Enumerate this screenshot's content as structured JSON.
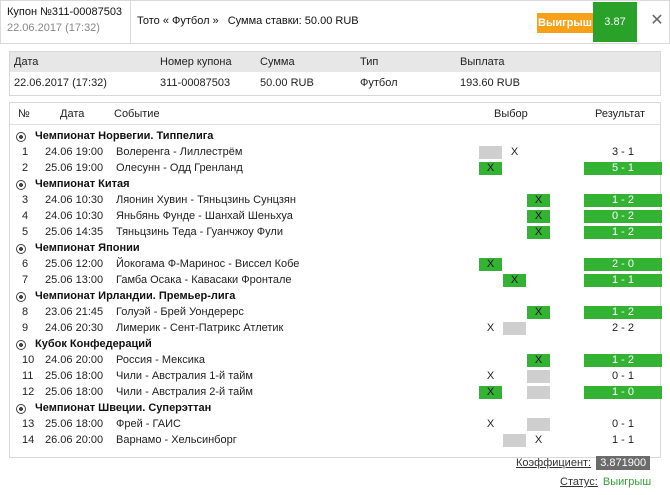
{
  "header": {
    "coupon_title": "Купон №311-00087503",
    "coupon_date": "22.06.2017 (17:32)",
    "type_text": "Тото « Футбол »",
    "sum_text": "Сумма ставки: 50.00 RUB",
    "win_badge": "Выигрыш",
    "coefficient": "3.87",
    "close_icon": "close-icon",
    "colors": {
      "win_badge": "#f7a11a",
      "coefficient_bg": "#2aa22a"
    }
  },
  "summary": {
    "headers": [
      "Дата",
      "Номер купона",
      "Сумма",
      "Тип",
      "Выплата"
    ],
    "values": [
      "22.06.2017 (17:32)",
      "311-00087503",
      "50.00 RUB",
      "Футбол",
      "193.60 RUB"
    ]
  },
  "matches": {
    "headers": {
      "num": "№",
      "date": "Дата",
      "event": "Событие",
      "choice": "Выбор",
      "result": "Результат"
    },
    "groups": [
      {
        "name": "Чемпионат Норвегии. Типпелига",
        "rows": [
          {
            "num": "1",
            "date": "24.06 19:00",
            "event": "Волеренга - Лиллестрём",
            "result": "3 - 1",
            "result_win": false,
            "sel": [
              {
                "kind": "grey",
                "text": ""
              },
              {
                "kind": "plain",
                "text": "X"
              },
              {
                "kind": "none",
                "text": ""
              }
            ]
          },
          {
            "num": "2",
            "date": "25.06 19:00",
            "event": "Олесунн - Одд Гренланд",
            "result": "5 - 1",
            "result_win": true,
            "sel": [
              {
                "kind": "green",
                "text": "X"
              },
              {
                "kind": "none",
                "text": ""
              },
              {
                "kind": "none",
                "text": ""
              }
            ]
          }
        ]
      },
      {
        "name": "Чемпионат Китая",
        "rows": [
          {
            "num": "3",
            "date": "24.06 10:30",
            "event": "Ляонин Хувин - Тяньцзинь Сунцзян",
            "result": "1 - 2",
            "result_win": true,
            "sel": [
              {
                "kind": "none",
                "text": ""
              },
              {
                "kind": "none",
                "text": ""
              },
              {
                "kind": "green",
                "text": "X"
              }
            ]
          },
          {
            "num": "4",
            "date": "24.06 10:30",
            "event": "Яньбянь Фунде - Шанхай Шеньхуа",
            "result": "0 - 2",
            "result_win": true,
            "sel": [
              {
                "kind": "none",
                "text": ""
              },
              {
                "kind": "none",
                "text": ""
              },
              {
                "kind": "green",
                "text": "X"
              }
            ]
          },
          {
            "num": "5",
            "date": "25.06 14:35",
            "event": "Тяньцзинь Теда - Гуанчжоу Фули",
            "result": "1 - 2",
            "result_win": true,
            "sel": [
              {
                "kind": "none",
                "text": ""
              },
              {
                "kind": "none",
                "text": ""
              },
              {
                "kind": "green",
                "text": "X"
              }
            ]
          }
        ]
      },
      {
        "name": "Чемпионат Японии",
        "rows": [
          {
            "num": "6",
            "date": "25.06 12:00",
            "event": "Йокогама Ф-Маринос - Виссел Кобе",
            "result": "2 - 0",
            "result_win": true,
            "sel": [
              {
                "kind": "green",
                "text": "X"
              },
              {
                "kind": "none",
                "text": ""
              },
              {
                "kind": "none",
                "text": ""
              }
            ]
          },
          {
            "num": "7",
            "date": "25.06 13:00",
            "event": "Гамба Осака - Кавасаки Фронтале",
            "result": "1 - 1",
            "result_win": true,
            "sel": [
              {
                "kind": "none",
                "text": ""
              },
              {
                "kind": "green",
                "text": "X"
              },
              {
                "kind": "none",
                "text": ""
              }
            ]
          }
        ]
      },
      {
        "name": "Чемпионат Ирландии. Премьер-лига",
        "rows": [
          {
            "num": "8",
            "date": "23.06 21:45",
            "event": "Голуэй - Брей Уондерерс",
            "result": "1 - 2",
            "result_win": true,
            "sel": [
              {
                "kind": "none",
                "text": ""
              },
              {
                "kind": "none",
                "text": ""
              },
              {
                "kind": "green",
                "text": "X"
              }
            ]
          },
          {
            "num": "9",
            "date": "24.06 20:30",
            "event": "Лимерик - Сент-Патрикс Атлетик",
            "result": "2 - 2",
            "result_win": false,
            "sel": [
              {
                "kind": "plain",
                "text": "X"
              },
              {
                "kind": "grey",
                "text": ""
              },
              {
                "kind": "none",
                "text": ""
              }
            ]
          }
        ]
      },
      {
        "name": "Кубок Конфедераций",
        "rows": [
          {
            "num": "10",
            "date": "24.06 20:00",
            "event": "Россия - Мексика",
            "result": "1 - 2",
            "result_win": true,
            "sel": [
              {
                "kind": "none",
                "text": ""
              },
              {
                "kind": "none",
                "text": ""
              },
              {
                "kind": "green",
                "text": "X"
              }
            ]
          },
          {
            "num": "11",
            "date": "25.06 18:00",
            "event": "Чили - Австралия 1-й тайм",
            "result": "0 - 1",
            "result_win": false,
            "sel": [
              {
                "kind": "plain",
                "text": "X"
              },
              {
                "kind": "none",
                "text": ""
              },
              {
                "kind": "grey",
                "text": ""
              }
            ]
          },
          {
            "num": "12",
            "date": "25.06 18:00",
            "event": "Чили - Австралия 2-й тайм",
            "result": "1 - 0",
            "result_win": true,
            "sel": [
              {
                "kind": "green",
                "text": "X"
              },
              {
                "kind": "none",
                "text": ""
              },
              {
                "kind": "grey",
                "text": ""
              }
            ]
          }
        ]
      },
      {
        "name": "Чемпионат Швеции. Суперэттан",
        "rows": [
          {
            "num": "13",
            "date": "25.06 18:00",
            "event": "Фрей - ГАИС",
            "result": "0 - 1",
            "result_win": false,
            "sel": [
              {
                "kind": "plain",
                "text": "X"
              },
              {
                "kind": "none",
                "text": ""
              },
              {
                "kind": "grey",
                "text": ""
              }
            ]
          },
          {
            "num": "14",
            "date": "26.06 20:00",
            "event": "Варнамо - Хельсинборг",
            "result": "1 - 1",
            "result_win": false,
            "sel": [
              {
                "kind": "none",
                "text": ""
              },
              {
                "kind": "grey",
                "text": ""
              },
              {
                "kind": "plain",
                "text": "X"
              }
            ]
          }
        ]
      }
    ]
  },
  "footer": {
    "coef_label": "Коэффициент:",
    "coef_value": "3.871900",
    "status_label": "Статус:",
    "status_value": "Выигрыш"
  }
}
